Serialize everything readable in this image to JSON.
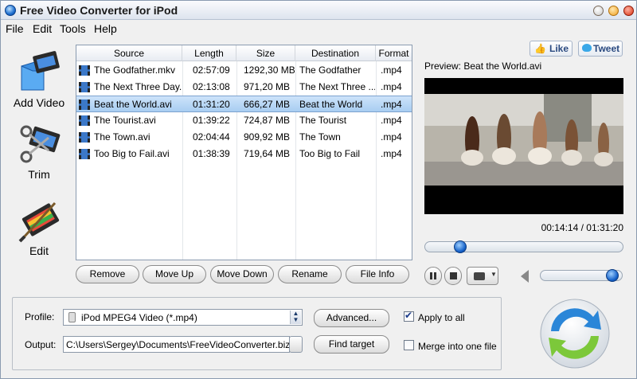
{
  "window": {
    "title": "Free Video Converter for iPod"
  },
  "menu": [
    "File",
    "Edit",
    "Tools",
    "Help"
  ],
  "sidebar": [
    {
      "label": "Add Video",
      "icon": "add-video-icon"
    },
    {
      "label": "Trim",
      "icon": "scissors-icon"
    },
    {
      "label": "Edit",
      "icon": "edit-video-icon"
    }
  ],
  "filelist": {
    "columns": [
      "Source",
      "Length",
      "Size",
      "Destination",
      "Format"
    ],
    "rows": [
      {
        "source": "The Godfather.mkv",
        "length": "02:57:09",
        "size": "1292,30 MB",
        "destination": "The Godfather",
        "format": ".mp4",
        "selected": false
      },
      {
        "source": "The Next Three Day...",
        "length": "02:13:08",
        "size": "971,20 MB",
        "destination": "The Next Three ...",
        "format": ".mp4",
        "selected": false
      },
      {
        "source": "Beat the World.avi",
        "length": "01:31:20",
        "size": "666,27 MB",
        "destination": "Beat the World",
        "format": ".mp4",
        "selected": true
      },
      {
        "source": "The Tourist.avi",
        "length": "01:39:22",
        "size": "724,87 MB",
        "destination": "The Tourist",
        "format": ".mp4",
        "selected": false
      },
      {
        "source": "The Town.avi",
        "length": "02:04:44",
        "size": "909,92 MB",
        "destination": "The Town",
        "format": ".mp4",
        "selected": false
      },
      {
        "source": "Too Big to Fail.avi",
        "length": "01:38:39",
        "size": "719,64 MB",
        "destination": "Too Big to Fail",
        "format": ".mp4",
        "selected": false
      }
    ]
  },
  "list_buttons": {
    "remove": "Remove",
    "move_up": "Move Up",
    "move_down": "Move Down",
    "rename": "Rename",
    "file_info": "File Info"
  },
  "social": {
    "like": "Like",
    "tweet": "Tweet"
  },
  "preview": {
    "label": "Preview: Beat the World.avi",
    "timecode": "00:14:14 / 01:31:20",
    "position": 0.156,
    "volume": 0.95
  },
  "profile": {
    "label": "Profile:",
    "value": "iPod MPEG4 Video (*.mp4)",
    "advanced": "Advanced...",
    "apply_all": "Apply to all",
    "apply_all_checked": true
  },
  "output": {
    "label": "Output:",
    "path": "C:\\Users\\Sergey\\Documents\\FreeVideoConverter.biz\\Free",
    "find_target": "Find target",
    "merge": "Merge into one file",
    "merge_checked": false
  },
  "colors": {
    "accent": "#1460c8",
    "selection": "#a8cdf1"
  }
}
